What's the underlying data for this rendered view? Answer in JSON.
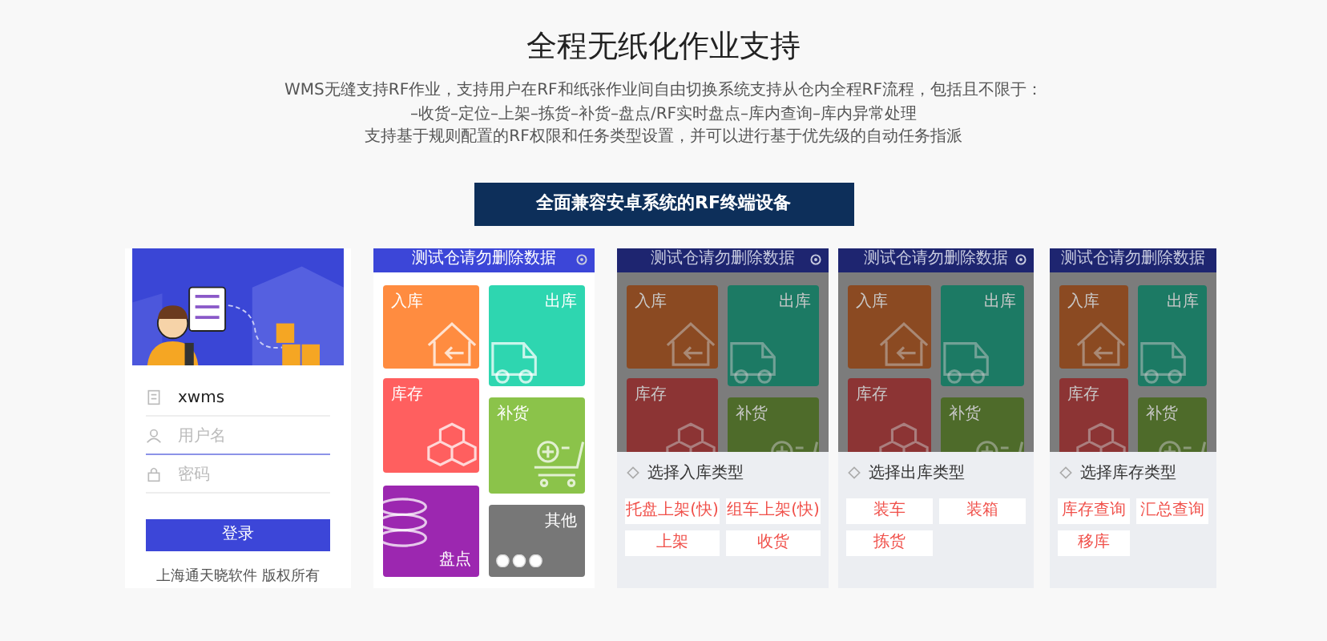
{
  "header": {
    "title": "全程无纸化作业支持",
    "description": [
      "WMS无缝支持RF作业，支持用户在RF和纸张作业间自由切换系统支持从仓内全程RF流程，包括且不限于：",
      "–收货–定位–上架–拣货–补货–盘点/RF实时盘点–库内查询–库内异常处理",
      "支持基于规则配置的RF权限和任务类型设置，并可以进行基于优先级的自动任务指派"
    ],
    "banner": "全面兼容安卓系统的RF终端设备"
  },
  "screens": [
    {
      "kind": "login",
      "site": "xwms",
      "username_placeholder": "用户名",
      "password_placeholder": "密码",
      "login_button": "登录",
      "footer": "上海通天晓软件 版权所有"
    },
    {
      "kind": "menu",
      "header": "测试仓请勿删除数据",
      "tiles": [
        {
          "label": "入库",
          "color": "#ff8c40"
        },
        {
          "label": "出库",
          "color": "#2ed6b0"
        },
        {
          "label": "库存",
          "color": "#ff5f5f"
        },
        {
          "label": "补货",
          "color": "#8bc34a"
        },
        {
          "label": "盘点",
          "color": "#9c27b0"
        },
        {
          "label": "其他",
          "color": "#777777"
        }
      ]
    },
    {
      "kind": "sheet",
      "header": "测试仓请勿删除数据",
      "tiles": [
        {
          "label": "入库",
          "color": "#8b4a22"
        },
        {
          "label": "出库",
          "color": "#1c7a64"
        },
        {
          "label": "库存",
          "color": "#8c3434"
        },
        {
          "label": "补货",
          "color": "#4e6b2a"
        }
      ],
      "sheet_title": "选择入库类型",
      "options": [
        "托盘上架(快)",
        "组车上架(快)",
        "上架",
        "收货"
      ]
    },
    {
      "kind": "sheet",
      "header": "测试仓请勿删除数据",
      "tiles": [
        {
          "label": "入库",
          "color": "#8b4a22"
        },
        {
          "label": "出库",
          "color": "#1c7a64"
        },
        {
          "label": "库存",
          "color": "#8c3434"
        },
        {
          "label": "补货",
          "color": "#4e6b2a"
        }
      ],
      "sheet_title": "选择出库类型",
      "options": [
        "装车",
        "装箱",
        "拣货"
      ]
    },
    {
      "kind": "sheet",
      "header": "测试仓请勿删除数据",
      "tiles": [
        {
          "label": "入库",
          "color": "#8b4a22"
        },
        {
          "label": "出库",
          "color": "#1c7a64"
        },
        {
          "label": "库存",
          "color": "#8c3434"
        },
        {
          "label": "补货",
          "color": "#4e6b2a"
        }
      ],
      "sheet_title": "选择库存类型",
      "options": [
        "库存查询",
        "汇总查询",
        "移库"
      ]
    }
  ]
}
